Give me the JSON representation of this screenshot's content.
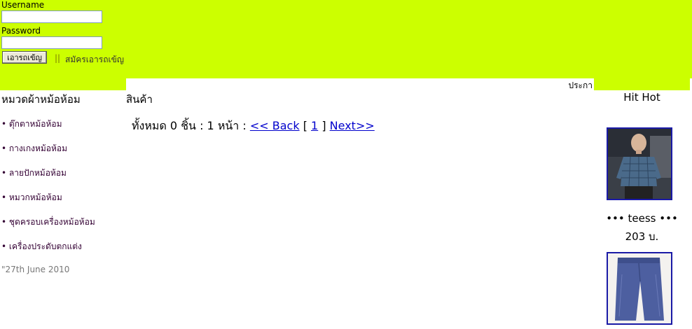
{
  "login": {
    "username_label": "Username",
    "password_label": "Password",
    "username_value": "",
    "password_value": "",
    "submit_label": "เอารถเข้ญ",
    "separator": "||",
    "register_label": "สมัครเอารถเข้ญ"
  },
  "marquee": {
    "text": "ประกา"
  },
  "categories": {
    "title": "หมวดผ้าหม้อห้อม",
    "items": [
      "• ตุ๊กตาหม้อห้อม",
      "• กางเกงหม้อห้อม",
      "• ลายปักหม้อห้อม",
      "• หมวกหม้อห้อม",
      "• ชุดครอบเครื่องหม้อห้อม",
      "• เครื่องประดับตกแต่ง"
    ],
    "date": "\"27th June 2010"
  },
  "products": {
    "title": "สินค้า",
    "summary": "ทั้งหมด 0 ชิ้น : 1 หน้า :",
    "back_label": "<< Back",
    "open_bracket": "[",
    "page": "1",
    "close_bracket": "]",
    "next_label": "Next>>"
  },
  "hit_hot": {
    "title": "Hit Hot",
    "items": [
      {
        "name": "••• teess •••",
        "price": "203 บ."
      },
      {
        "name": "",
        "price": ""
      }
    ]
  },
  "colors": {
    "header_bg": "#ccff00",
    "link": "#0000cc",
    "thumb_border": "#1a1aa6"
  }
}
